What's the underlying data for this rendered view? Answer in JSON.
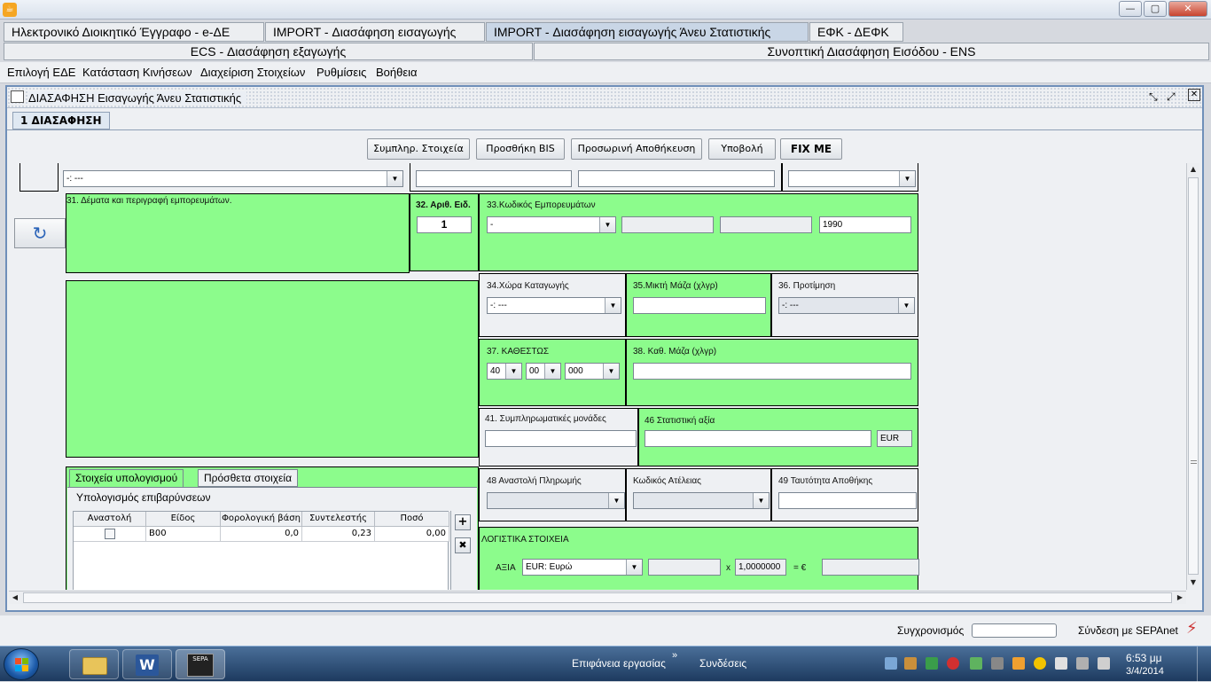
{
  "window": {
    "minimize": "—",
    "maximize": "▢",
    "close": "✕",
    "app_icon": "java-icon"
  },
  "app_tabs": [
    {
      "label": "Ηλεκτρονικό Διοικητικό Έγγραφο - e-ΔΕ"
    },
    {
      "label": "IMPORT - Διασάφηση εισαγωγής"
    },
    {
      "label": "IMPORT - Διασάφηση εισαγωγής Άνευ Στατιστικής"
    },
    {
      "label": "ΕΦΚ - ΔΕΦΚ"
    },
    {
      "label": "ECS - Διασάφηση εξαγωγής"
    },
    {
      "label": "Συνοπτική Διασάφηση Εισόδου - ENS"
    }
  ],
  "menu": [
    "Επιλογή ΕΔΕ",
    "Κατάσταση Κινήσεων",
    "Διαχείριση Στοιχείων",
    "Ρυθμίσεις",
    "Βοήθεια"
  ],
  "frame": {
    "title": "ΔΙΑΣΑΦΗΣΗ Εισαγωγής Άνευ Στατιστικής",
    "tab": "1 ΔΙΑΣΑΦΗΣΗ"
  },
  "toolbar": {
    "fill": "Συμπληρ. Στοιχεία",
    "add_bis": "Προσθήκη BIS",
    "temp_save": "Προσωρινή Αποθήκευση",
    "submit": "Υποβολή",
    "fix": "FIX ME"
  },
  "form": {
    "top_combo": "-: ---",
    "box31": "31. Δέματα και περιγραφή εμπορευμάτων.",
    "box32": {
      "label": "32. Αριθ. Ειδ.",
      "value": "1"
    },
    "box33": {
      "label": "33.Κωδικός Εμπορευμάτων",
      "combo": "-",
      "extra": "1990"
    },
    "box34": {
      "label": "34.Χώρα Καταγωγής",
      "combo": "-: ---"
    },
    "box35": {
      "label": "35.Μικτή Μάζα (χλγρ)"
    },
    "box36": {
      "label": "36. Προτίμηση",
      "combo": "-: ---"
    },
    "box37": {
      "label": "37. ΚΑΘΕΣΤΩΣ",
      "c1": "40",
      "c2": "00",
      "c3": "000"
    },
    "box38": {
      "label": "38. Καθ. Μάζα (χλγρ)"
    },
    "box41": {
      "label": "41. Συμπληρωματικές μονάδες"
    },
    "box46": {
      "label": "46 Στατιστική αξία",
      "currency": "EUR"
    },
    "box48": {
      "label": "48 Αναστολή Πληρωμής"
    },
    "exemption": {
      "label": "Κωδικός Ατέλειας"
    },
    "box49": {
      "label": "49 Ταυτότητα Αποθήκης"
    },
    "accounting": {
      "title": "ΛΟΓΙΣΤΙΚΑ ΣΤΟΙΧΕΙΑ",
      "value_label": "ΑΞΙΑ",
      "currency": "EUR: Ευρώ",
      "times": "x",
      "rate": "1,0000000",
      "eq": "= €"
    }
  },
  "calc": {
    "tab1": "Στοιχεία υπολογισμού",
    "tab2": "Πρόσθετα στοιχεία",
    "group": "Υπολογισμός επιβαρύνσεων",
    "columns": [
      "Αναστολή",
      "Είδος",
      "Φορολογική βάση",
      "Συντελεστής",
      "Ποσό"
    ],
    "rows": [
      {
        "type": "B00",
        "base": "0,0",
        "rate": "0,23",
        "amount": "0,00"
      }
    ]
  },
  "status": {
    "sync": "Συγχρονισμός",
    "sepa": "Σύνδεση με SEPAnet"
  },
  "taskbar": {
    "desktop": "Επιφάνεια εργασίας",
    "links": "Συνδέσεις",
    "time": "6:53 μμ",
    "date": "3/4/2014",
    "chevron": "»",
    "sepa_label": "SEPA"
  }
}
